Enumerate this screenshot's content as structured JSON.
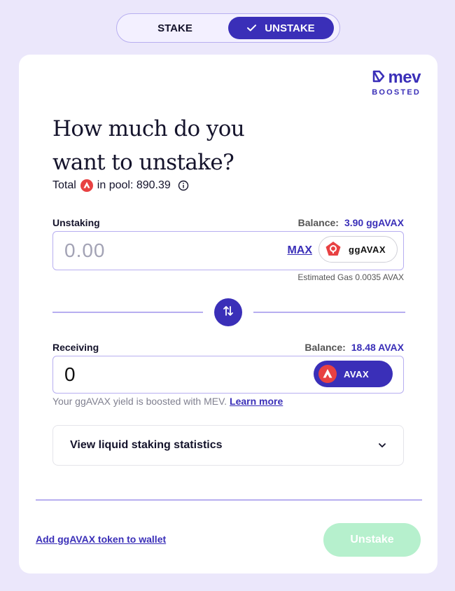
{
  "toggle": {
    "stake_label": "STAKE",
    "unstake_label": "UNSTAKE",
    "active": "unstake"
  },
  "brand": {
    "name": "mev",
    "subtitle": "BOOSTED"
  },
  "heading": {
    "line1": "How much do you",
    "line2": "want to unstake?"
  },
  "pool": {
    "prefix": "Total",
    "suffix": "in pool: 890.39",
    "token_icon": "avax-icon"
  },
  "unstaking": {
    "label": "Unstaking",
    "balance_label": "Balance:",
    "balance_value": "3.90 ggAVAX",
    "placeholder": "0.00",
    "max_label": "MAX",
    "token": "ggAVAX",
    "gas_text": "Estimated Gas 0.0035 AVAX"
  },
  "receiving": {
    "label": "Receiving",
    "balance_label": "Balance:",
    "balance_value": "18.48 AVAX",
    "value": "0",
    "token": "AVAX"
  },
  "yield_note": {
    "text": "Your ggAVAX yield is boosted with MEV.",
    "link": "Learn more"
  },
  "stats": {
    "label": "View liquid staking statistics"
  },
  "footer": {
    "add_token_link": "Add ggAVAX token to wallet",
    "unstake_button": "Unstake"
  },
  "colors": {
    "accent": "#3a2fb8",
    "background": "#ebe7fb",
    "avax_red": "#e84142",
    "disabled_button": "#b6f0cd"
  }
}
